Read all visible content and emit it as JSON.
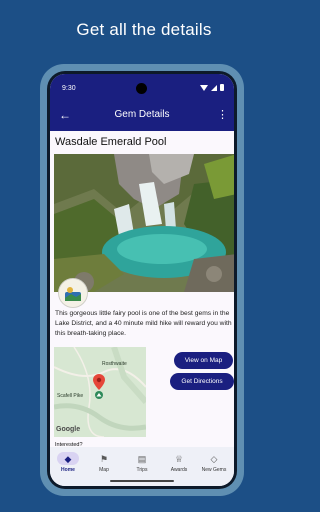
{
  "headline": "Get all the details",
  "status_bar": {
    "time": "9:30"
  },
  "app_bar": {
    "title": "Gem Details",
    "back_icon": "arrow-back-icon",
    "menu_icon": "more-vert-icon"
  },
  "gem": {
    "name": "Wasdale Emerald Pool",
    "description": "This gorgeous little fairy pool is one of the best gems in the Lake District, and a 40 minute mild hike will reward you with this breath-taking place."
  },
  "map": {
    "labels": {
      "town": "Rosthwaite",
      "peak": "Scafell Pike"
    },
    "attribution": "Google"
  },
  "actions": {
    "view_on_map": "View on Map",
    "get_directions": "Get Directions"
  },
  "interested_label": "Interested?",
  "bottom_nav": [
    {
      "label": "Home",
      "icon": "gem-icon",
      "active": true
    },
    {
      "label": "Map",
      "icon": "map-icon",
      "active": false
    },
    {
      "label": "Trips",
      "icon": "trips-icon",
      "active": false
    },
    {
      "label": "Awards",
      "icon": "trophy-icon",
      "active": false
    },
    {
      "label": "New Gems",
      "icon": "new-gem-icon",
      "active": false
    }
  ],
  "colors": {
    "primary": "#1a1f80",
    "background": "#1c4f86",
    "device_frame": "#5f8fb2",
    "nav_active": "#d9d3f2"
  }
}
